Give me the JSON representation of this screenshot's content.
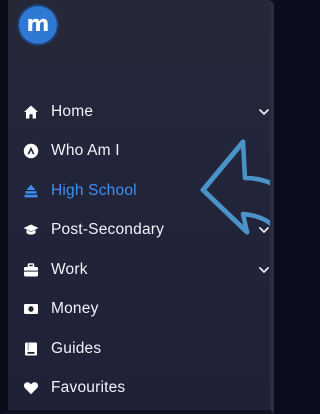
{
  "logo": {
    "letter": "m"
  },
  "colors": {
    "accent": "#3d8ff2",
    "text": "#f2f3f8",
    "background": "#22243a",
    "annotation_arrow": "#4a93c9"
  },
  "nav": {
    "items": [
      {
        "label": "Home",
        "icon": "home-icon",
        "has_submenu": true,
        "active": false
      },
      {
        "label": "Who Am I",
        "icon": "person-circle-icon",
        "has_submenu": false,
        "active": false
      },
      {
        "label": "High School",
        "icon": "school-icon",
        "has_submenu": false,
        "active": true
      },
      {
        "label": "Post-Secondary",
        "icon": "graduation-cap-icon",
        "has_submenu": true,
        "active": false
      },
      {
        "label": "Work",
        "icon": "briefcase-icon",
        "has_submenu": true,
        "active": false
      },
      {
        "label": "Money",
        "icon": "money-icon",
        "has_submenu": false,
        "active": false
      },
      {
        "label": "Guides",
        "icon": "book-icon",
        "has_submenu": false,
        "active": false
      },
      {
        "label": "Favourites",
        "icon": "heart-icon",
        "has_submenu": false,
        "active": false
      }
    ]
  }
}
